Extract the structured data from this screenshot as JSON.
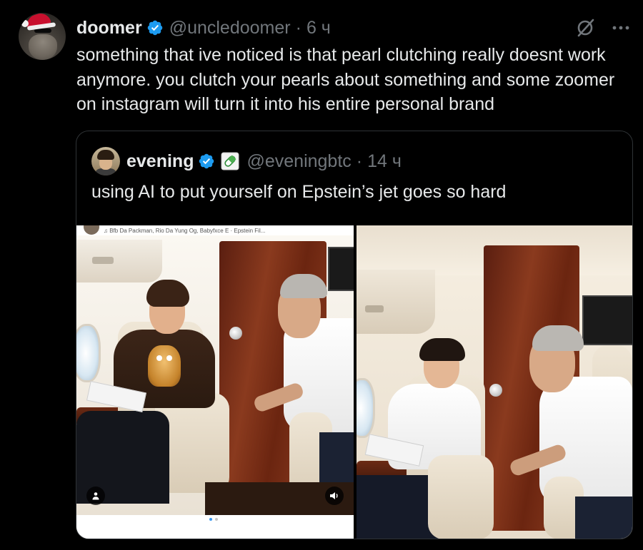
{
  "tweet": {
    "author_name": "doomer",
    "author_handle": "@uncledoomer",
    "separator": "·",
    "time": "6 ч",
    "text": "something that ive noticed is that pearl clutching really doesnt work anymore. you clutch your pearls about something and some zoomer on instagram will turn it into his entire personal brand"
  },
  "quote": {
    "author_name": "evening",
    "author_handle": "@eveningbtc",
    "separator": "·",
    "time": "14 ч",
    "text": "using AI to put yourself on Epstein’s jet goes so hard"
  },
  "media": {
    "left_caption": "♫ Bfb Da Packman, Rio Da Yung Og, Babyfxce E · Epstein Fil...",
    "carousel_dots": 2,
    "carousel_active_index": 0
  },
  "colors": {
    "background": "#000000",
    "text": "#e7e9ea",
    "muted": "#71767b",
    "verified": "#1d9bf0",
    "border": "#2f3336"
  },
  "icons": {
    "verified": "verified-badge-icon",
    "grok": "grok-icon",
    "more": "more-icon",
    "badge": "pill-badge-icon",
    "user": "user-icon",
    "sound": "sound-icon"
  }
}
